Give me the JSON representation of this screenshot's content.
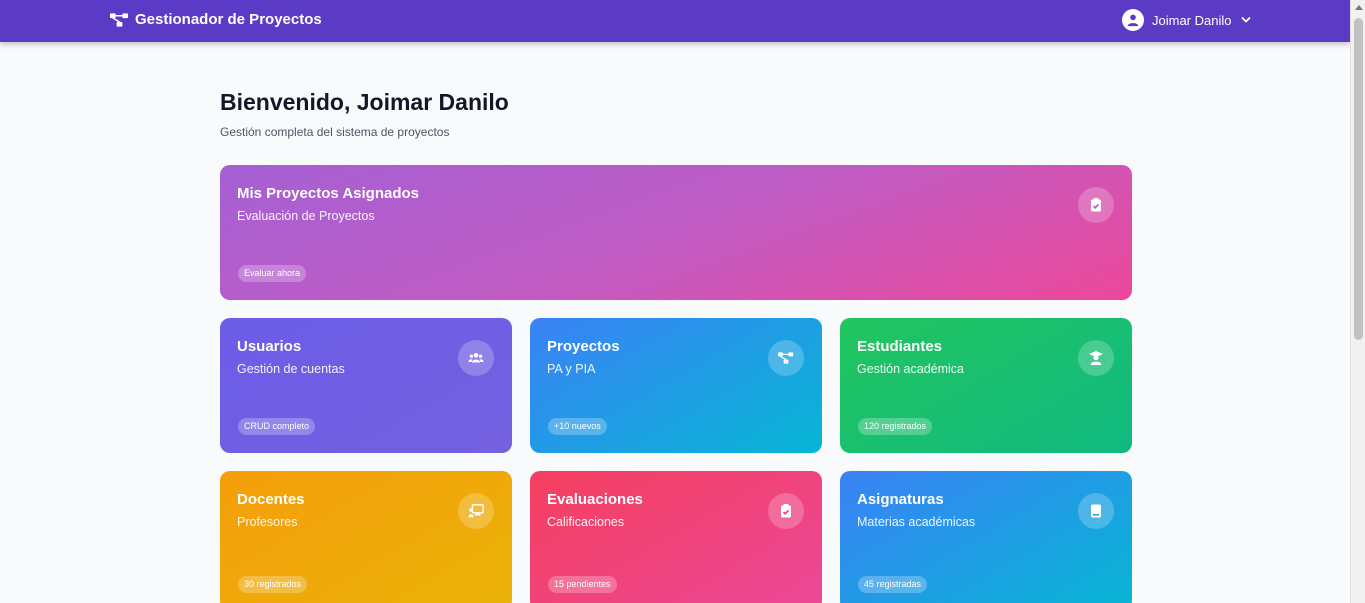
{
  "navbar": {
    "brand": "Gestionador de Proyectos",
    "user_name": "Joimar Danilo"
  },
  "header": {
    "title": "Bienvenido, Joimar Danilo",
    "subtitle": "Gestión completa del sistema de proyectos"
  },
  "cards": [
    {
      "title": "Mis Proyectos Asignados",
      "subtitle": "Evaluación de Proyectos",
      "badge": "Evaluar ahora",
      "icon": "clipboard-check-icon"
    },
    {
      "title": "Usuarios",
      "subtitle": "Gestión de cuentas",
      "badge": "CRUD completo",
      "icon": "users-icon"
    },
    {
      "title": "Proyectos",
      "subtitle": "PA y PIA",
      "badge": "+10 nuevos",
      "icon": "project-diagram-icon"
    },
    {
      "title": "Estudiantes",
      "subtitle": "Gestión académica",
      "badge": "120 registrados",
      "icon": "student-icon"
    },
    {
      "title": "Docentes",
      "subtitle": "Profesores",
      "badge": "30 registrados",
      "icon": "teacher-board-icon"
    },
    {
      "title": "Evaluaciones",
      "subtitle": "Calificaciones",
      "badge": "15 pendientes",
      "icon": "clipboard-check-icon"
    },
    {
      "title": "Asignaturas",
      "subtitle": "Materias académicas",
      "badge": "45 registradas",
      "icon": "book-icon"
    }
  ]
}
